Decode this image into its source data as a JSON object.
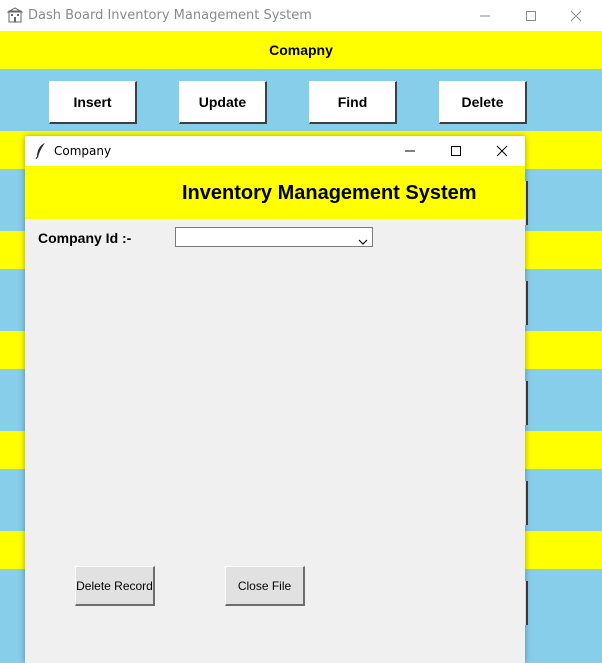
{
  "main_window": {
    "title": "Dash Board Inventory Management System",
    "banner": "Comapny",
    "buttons": {
      "insert": "Insert",
      "update": "Update",
      "find": "Find",
      "delete": "Delete"
    }
  },
  "dialog": {
    "title": "Company",
    "heading": "Inventory Management System",
    "company_id_label": "Company Id :-",
    "company_id_value": "",
    "delete_record_label": "Delete Record",
    "close_file_label": "Close File"
  },
  "colors": {
    "background": "#87ceeb",
    "banner": "#ffff00",
    "dialog_body": "#f0f0f0"
  },
  "icons": {
    "app": "building-icon",
    "dialog": "feather-icon",
    "minimize": "minimize-icon",
    "maximize": "maximize-icon",
    "close": "close-icon",
    "dropdown": "chevron-down-icon"
  }
}
